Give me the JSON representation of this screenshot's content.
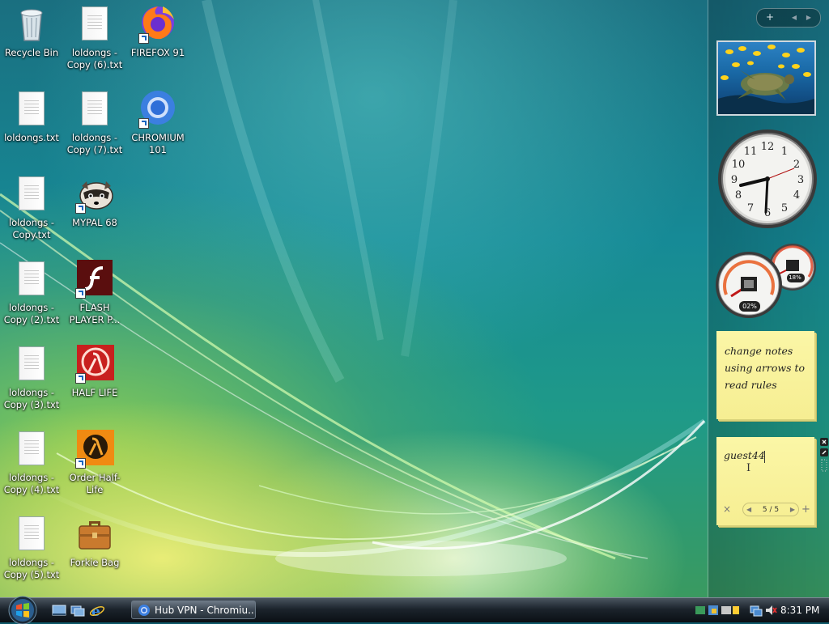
{
  "desktop_icons": [
    {
      "name": "recycle-bin",
      "label": "Recycle Bin",
      "icon": "recycle-bin-icon"
    },
    {
      "name": "loldongs-copy-6",
      "label": "loldongs - Copy (6).txt",
      "icon": "text-file-icon"
    },
    {
      "name": "firefox-91",
      "label": "FIREFOX 91",
      "icon": "firefox-icon"
    },
    {
      "name": "loldongs",
      "label": "loldongs.txt",
      "icon": "text-file-icon"
    },
    {
      "name": "loldongs-copy-7",
      "label": "loldongs - Copy (7).txt",
      "icon": "text-file-icon"
    },
    {
      "name": "chromium-101",
      "label": "CHROMIUM 101",
      "icon": "chromium-icon"
    },
    {
      "name": "loldongs-copy",
      "label": "loldongs - Copy.txt",
      "icon": "text-file-icon"
    },
    {
      "name": "mypal-68",
      "label": "MYPAL 68",
      "icon": "raccoon-icon"
    },
    {
      "name": "loldongs-copy-2",
      "label": "loldongs - Copy (2).txt",
      "icon": "text-file-icon"
    },
    {
      "name": "flash-player",
      "label": "FLASH PLAYER P...",
      "icon": "flash-icon"
    },
    {
      "name": "loldongs-copy-3",
      "label": "loldongs - Copy (3).txt",
      "icon": "text-file-icon"
    },
    {
      "name": "half-life",
      "label": "HALF LIFE",
      "icon": "half-life-icon"
    },
    {
      "name": "loldongs-copy-4",
      "label": "loldongs - Copy (4).txt",
      "icon": "text-file-icon"
    },
    {
      "name": "order-half-life",
      "label": "Order Half-Life",
      "icon": "half-life-orange-icon"
    },
    {
      "name": "loldongs-copy-5",
      "label": "loldongs - Copy (5).txt",
      "icon": "text-file-icon"
    },
    {
      "name": "forkie-bag",
      "label": "Forkie Bag",
      "icon": "briefcase-icon"
    }
  ],
  "sidebar": {
    "controls": {
      "add": "+",
      "prev": "◀",
      "next": "▶"
    },
    "cpu_meter": {
      "cpu_percent": "02%",
      "memory_percent": "18%"
    },
    "note1": {
      "text": "change notes using arrows to read rules"
    },
    "note2": {
      "text": "guest44",
      "page": "5 / 5",
      "close": "×",
      "prev": "◀",
      "next": "▶",
      "add": "+"
    }
  },
  "taskbar": {
    "task_button": "Hub VPN - Chromiu...",
    "clock": "8:31 PM"
  },
  "colors": {
    "note_yellow": "#f8f09c",
    "taskbar_dark": "#1c242c"
  }
}
